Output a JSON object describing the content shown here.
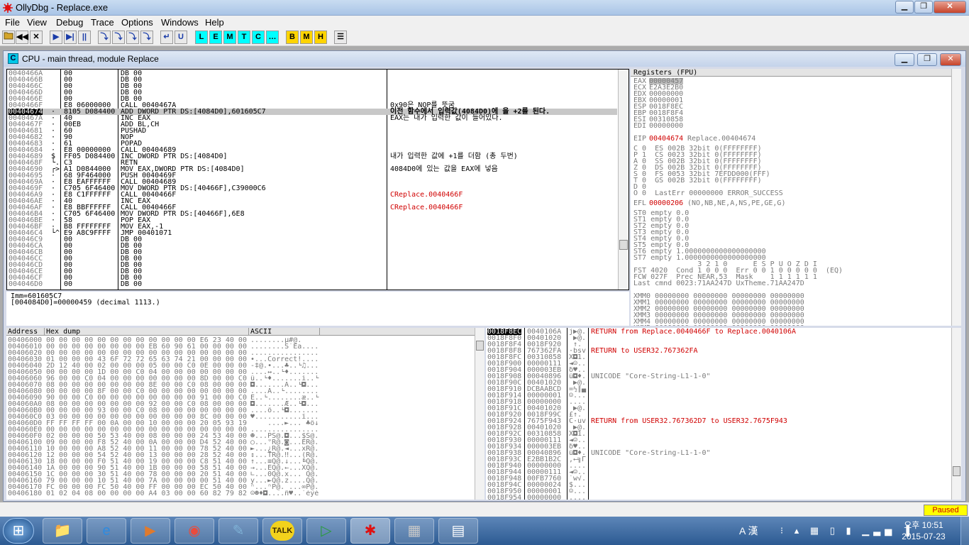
{
  "window": {
    "title": "OllyDbg - Replace.exe"
  },
  "menu": [
    "File",
    "View",
    "Debug",
    "Trace",
    "Options",
    "Windows",
    "Help"
  ],
  "toolbar": {
    "blue": [
      "◀◀",
      "✕",
      "▶",
      "▶|",
      "||",
      "⤵",
      "⤵",
      "⤵",
      "⤵",
      "↵",
      "U"
    ],
    "cyan": [
      "L",
      "E",
      "M",
      "T",
      "C",
      "…"
    ],
    "yellow": [
      "B",
      "M",
      "H"
    ],
    "list": "☰"
  },
  "cpu": {
    "title": "CPU - main thread, module Replace",
    "disasm": [
      {
        "addr": "0040466A",
        "mark": "",
        "hex": "00",
        "asm": "DB 00",
        "cmt": ""
      },
      {
        "addr": "0040466B",
        "mark": "",
        "hex": "00",
        "asm": "DB 00",
        "cmt": ""
      },
      {
        "addr": "0040466C",
        "mark": "",
        "hex": "00",
        "asm": "DB 00",
        "cmt": ""
      },
      {
        "addr": "0040466D",
        "mark": "",
        "hex": "00",
        "asm": "DB 00",
        "cmt": ""
      },
      {
        "addr": "0040466E",
        "mark": "",
        "hex": "00",
        "asm": "DB 00",
        "cmt": ""
      },
      {
        "addr": "0040466F",
        "mark": "",
        "hex": "E8 06000000",
        "asm": "CALL 0040467A",
        "cmt": "0x90은 NOP를 뜻굼"
      },
      {
        "addr": "00404674",
        "mark": "·",
        "hex": "8105 D084400",
        "asm": "ADD DWORD PTR DS:[4084D0],601605C7",
        "cmt": "이전 함수에서 입력값(4084D0)에 을 +2를 된다.",
        "sel": true
      },
      {
        "addr": "0040467A",
        "mark": "·",
        "hex": "40",
        "asm": "INC EAX",
        "cmt": "EAX는 내가 입력한 값이 들어있다."
      },
      {
        "addr": "0040467F",
        "mark": "·",
        "hex": "00EB",
        "asm": "ADD BL,CH",
        "cmt": ""
      },
      {
        "addr": "00404681",
        "mark": "·",
        "hex": "60",
        "asm": "PUSHAD",
        "cmt": ""
      },
      {
        "addr": "00404682",
        "mark": "·",
        "hex": "90",
        "asm": "NOP",
        "cmt": ""
      },
      {
        "addr": "00404683",
        "mark": "·",
        "hex": "61",
        "asm": "POPAD",
        "cmt": ""
      },
      {
        "addr": "00404684",
        "mark": "·",
        "hex": "E8 00000000",
        "asm": "CALL 00404689",
        "cmt": ""
      },
      {
        "addr": "00404689",
        "mark": "$",
        "hex": "FF05 D084400",
        "asm": "INC DWORD PTR DS:[4084D0]",
        "cmt": "내가 입력한 값에 +1를 더함 (총 두번)"
      },
      {
        "addr": "0040468F",
        "mark": "└.",
        "hex": "C3",
        "asm": "RETN",
        "cmt": ""
      },
      {
        "addr": "00404690",
        "mark": "┌>",
        "hex": "A1 D0844000",
        "asm": "MOV EAX,DWORD PTR DS:[4084D0]",
        "cmt": "4084D0에 있는 값을 EAX에 넣음"
      },
      {
        "addr": "00404695",
        "mark": "·",
        "hex": "68 9F464000",
        "asm": "PUSH 0040469F",
        "cmt": ""
      },
      {
        "addr": "0040469A",
        "mark": "·",
        "hex": "E8 EAFFFFFF",
        "asm": "CALL 00404689",
        "cmt": ""
      },
      {
        "addr": "0040469F",
        "mark": "·",
        "hex": "C705 6F46400",
        "asm": "MOV DWORD PTR DS:[40466F],C39000C6",
        "cmt": ""
      },
      {
        "addr": "004046A9",
        "mark": "·",
        "hex": "E8 C1FFFFFF",
        "asm": "CALL 0040466F",
        "cmt": "CReplace.0040466F",
        "cmtred": true
      },
      {
        "addr": "004046AE",
        "mark": "·",
        "hex": "40",
        "asm": "INC EAX",
        "cmt": ""
      },
      {
        "addr": "004046AF",
        "mark": "·",
        "hex": "E8 BBFFFFFF",
        "asm": "CALL 0040466F",
        "cmt": "CReplace.0040466F",
        "cmtred": true
      },
      {
        "addr": "004046B4",
        "mark": "·",
        "hex": "C705 6F46400",
        "asm": "MOV DWORD PTR DS:[40466F],6E8",
        "cmt": ""
      },
      {
        "addr": "004046BE",
        "mark": "·",
        "hex": "58",
        "asm": "POP EAX",
        "cmt": ""
      },
      {
        "addr": "004046BF",
        "mark": "·",
        "hex": "B8 FFFFFFFF",
        "asm": "MOV EAX,-1",
        "cmt": ""
      },
      {
        "addr": "004046C4",
        "mark": "└^",
        "hex": "E9 A8C9FFFF",
        "asm": "JMP 00401071",
        "cmt": ""
      },
      {
        "addr": "004046C9",
        "mark": "",
        "hex": "00",
        "asm": "DB 00",
        "cmt": ""
      },
      {
        "addr": "004046CA",
        "mark": "",
        "hex": "00",
        "asm": "DB 00",
        "cmt": ""
      },
      {
        "addr": "004046CB",
        "mark": "",
        "hex": "00",
        "asm": "DB 00",
        "cmt": ""
      },
      {
        "addr": "004046CC",
        "mark": "",
        "hex": "00",
        "asm": "DB 00",
        "cmt": ""
      },
      {
        "addr": "004046CD",
        "mark": "",
        "hex": "00",
        "asm": "DB 00",
        "cmt": ""
      },
      {
        "addr": "004046CE",
        "mark": "",
        "hex": "00",
        "asm": "DB 00",
        "cmt": ""
      },
      {
        "addr": "004046CF",
        "mark": "",
        "hex": "00",
        "asm": "DB 00",
        "cmt": ""
      },
      {
        "addr": "004046D0",
        "mark": "",
        "hex": "00",
        "asm": "DB 00",
        "cmt": ""
      }
    ],
    "info": [
      "Imm=601605C7",
      "[004084D0]=00000459 (decimal 1113.)"
    ],
    "registers": {
      "header": "Registers (FPU)",
      "gpr": [
        {
          "n": "EAX",
          "v": "00000457",
          "hl": true,
          "extra": ""
        },
        {
          "n": "ECX",
          "v": "E2A3E2B0",
          "extra": ""
        },
        {
          "n": "EDX",
          "v": "00000000",
          "extra": ""
        },
        {
          "n": "EBX",
          "v": "00000001",
          "extra": ""
        },
        {
          "n": "ESP",
          "v": "0018F8EC",
          "extra": ""
        },
        {
          "n": "EBP",
          "v": "0018F8F4",
          "extra": ""
        },
        {
          "n": "ESI",
          "v": "00310858",
          "extra": ""
        },
        {
          "n": "EDI",
          "v": "00000000",
          "extra": ""
        }
      ],
      "eip": {
        "n": "EIP",
        "v": "00404674",
        "extra": "Replace.00404674"
      },
      "flags": [
        "C 0  ES 002B 32bit 0(FFFFFFFF)",
        "P 1  CS 0023 32bit 0(FFFFFFFF)",
        "A 0  SS 002B 32bit 0(FFFFFFFF)",
        "Z 0  DS 002B 32bit 0(FFFFFFFF)",
        "S 0  FS 0053 32bit 7EFDD000(FFF)",
        "T 0  GS 002B 32bit 0(FFFFFFFF)",
        "D 0",
        "O 0  LastErr 00000000 ERROR_SUCCESS"
      ],
      "efl": {
        "n": "EFL",
        "v": "00000206",
        "extra": "(NO,NB,NE,A,NS,PE,GE,G)"
      },
      "fpu": [
        "ST0 empty 0.0",
        "ST1 empty 0.0",
        "ST2 empty 0.0",
        "ST3 empty 0.0",
        "ST4 empty 0.0",
        "ST5 empty 0.0",
        "ST6 empty 1.0000000000000000000",
        "ST7 empty 1.0000000000000000000",
        "               3 2 1 0      E S P U O Z D I",
        "FST 4020  Cond 1 0 0 0  Err 0 0 1 0 0 0 0 0  (EQ)",
        "FCW 027F  Prec NEAR,53  Mask    1 1 1 1 1 1",
        "Last cmnd 0023:71AA247D UxTheme.71AA247D"
      ],
      "xmm": [
        "XMM0 00000000 00000000 00000000 00000000",
        "XMM1 00000000 00000000 00000000 00000000",
        "XMM2 00000000 00000000 00000000 00000000",
        "XMM3 00000000 00000000 00000000 00000000",
        "XMM4 00000000 00000000 00000000 00000000",
        "XMM5 00000000 00000000 00000000 00000000"
      ]
    },
    "dump": {
      "headers": [
        "Address",
        "Hex dump",
        "ASCII"
      ],
      "rows": [
        [
          "00406000",
          "00 00 00 00 00 00 00 00 00 00 00 00 E6 23 40 00",
          "........µ#@."
        ],
        [
          "00406010",
          "00 00 00 00 00 00 00 00 EB 60 90 61 00 00 00 00",
          "........Š`Ea...."
        ],
        [
          "00406020",
          "00 00 00 00 00 00 00 00 00 00 00 00 00 00 00 00",
          "................"
        ],
        [
          "00406030",
          "01 00 00 00 43 6F 72 72 65 63 74 21 00 00 00 00",
          "•...Correct!...."
        ],
        [
          "00406040",
          "2D 12 40 00 02 00 00 00 05 00 00 C0 0E 00 00 00",
          "-‡@.•...♣..└♫..."
        ],
        [
          "00406050",
          "00 00 00 00 1D 00 00 C0 04 00 00 00 00 00 00 00",
          "....↔..└♦......."
        ],
        [
          "00406060",
          "96 00 00 C0 04 00 00 00 00 00 00 00 8D 00 00 C0",
          "û..└♦.......ì..└"
        ],
        [
          "00406070",
          "08 00 00 00 00 00 00 00 8E 00 00 C0 08 00 00 00",
          "◘.......Ä..└◘..."
        ],
        [
          "00406080",
          "00 00 00 00 8F 00 00 C0 00 00 00 00 00 00 00 00",
          "....Å..└........"
        ],
        [
          "00406090",
          "90 00 00 C0 00 00 00 00 00 00 00 00 91 00 00 C0",
          "É..└........æ..└"
        ],
        [
          "004060A0",
          "08 00 00 00 00 00 00 00 92 00 00 C0 08 00 00 00",
          "◘.......Æ..└◘..."
        ],
        [
          "004060B0",
          "00 00 00 00 93 00 00 C0 08 00 00 00 00 00 00 00",
          "....ô..└◘......."
        ],
        [
          "004060C0",
          "03 00 00 00 00 00 00 00 00 00 00 00 8C 00 00 00",
          "♥...........î..."
        ],
        [
          "004060D0",
          "FF FF FF FF 00 0A 00 00 10 00 00 00 20 05 93 19",
          "    ....►... ♣ô↓"
        ],
        [
          "004060E0",
          "00 00 00 00 00 00 00 00 00 00 00 00 00 00 00 00",
          "................"
        ],
        [
          "004060F0",
          "02 00 00 00 50 53 40 00 08 00 00 00 24 53 40 00",
          "☻...PS@.◘...$S@."
        ],
        [
          "00406100",
          "09 00 00 00 F8 52 40 00 0A 00 00 00 D4 52 40 00",
          "○...°R@.◙...ÈR@."
        ],
        [
          "00406110",
          "10 00 00 00 A8 52 40 00 11 00 00 00 78 52 40 00",
          "►...¿R@.◄...xR@."
        ],
        [
          "00406120",
          "12 00 00 00 54 52 40 00 13 00 00 00 28 52 40 00",
          "↕...TR@.‼...(R@."
        ],
        [
          "00406130",
          "18 00 00 00 F0 51 40 00 19 00 00 00 C8 51 40 00",
          "↑...≡Q@.↓...╚Q@."
        ],
        [
          "00406140",
          "1A 00 00 00 90 51 40 00 1B 00 00 00 58 51 40 00",
          "→...ÉQ@.←...XQ@."
        ],
        [
          "00406150",
          "1C 00 00 00 30 51 40 00 78 00 00 00 20 51 40 00",
          "∟...0Q@.x... Q@."
        ],
        [
          "00406160",
          "79 00 00 00 10 51 40 00 7A 00 00 00 00 51 40 00",
          "y...►Q@.z....Q@."
        ],
        [
          "00406170",
          "FC 00 00 00 FC 50 40 00 FF 00 00 00 EC 50 40 00",
          "ⁿ...ⁿP@. ...∞P@."
        ],
        [
          "00406180",
          "01 02 04 08 00 00 00 00 A4 03 00 00 60 82 79 82",
          "☺☻♦◘....ñ♥..`éyé"
        ]
      ]
    },
    "stack": {
      "rows": [
        {
          "a": "0018F8EC",
          "v": "0040106A",
          "g": "j▶@.",
          "c": "RETURN from Replace.0040466F to Replace.0040106A",
          "red": true,
          "sel": true
        },
        {
          "a": "0018F8F0",
          "v": "00401020",
          "g": " ▶@.",
          "c": ""
        },
        {
          "a": "0018F8F4",
          "v": "0018F920",
          "g": " ↑.",
          "c": ""
        },
        {
          "a": "0018F8F8",
          "v": "767362FA",
          "g": "·bsv",
          "c": "RETURN to USER32.767362FA",
          "red": true
        },
        {
          "a": "0018F8FC",
          "v": "00310858",
          "g": "X◘1.",
          "c": ""
        },
        {
          "a": "0018F900",
          "v": "00000111",
          "g": "◄☺..",
          "c": ""
        },
        {
          "a": "0018F904",
          "v": "000003EB",
          "g": "δ♥..",
          "c": ""
        },
        {
          "a": "0018F908",
          "v": "00040896",
          "g": "û◘♦.",
          "c": "UNICODE \"Core-String-L1-1-0\""
        },
        {
          "a": "0018F90C",
          "v": "00401020",
          "g": " ▶@.",
          "c": ""
        },
        {
          "a": "0018F910",
          "v": "DCBAABCD",
          "g": "=½║▄",
          "c": ""
        },
        {
          "a": "0018F914",
          "v": "00000001",
          "g": "☺...",
          "c": ""
        },
        {
          "a": "0018F918",
          "v": "00000000",
          "g": "....",
          "c": ""
        },
        {
          "a": "0018F91C",
          "v": "00401020",
          "g": " ▶@.",
          "c": ""
        },
        {
          "a": "0018F920",
          "v": "0018F99C",
          "g": "£↑.",
          "c": ""
        },
        {
          "a": "0018F924",
          "v": "7675F943",
          "g": "C·uv",
          "c": "RETURN from USER32.767362D7 to USER32.7675F943",
          "red": true
        },
        {
          "a": "0018F928",
          "v": "00401020",
          "g": " ▶@.",
          "c": ""
        },
        {
          "a": "0018F92C",
          "v": "00310858",
          "g": "X◘1.",
          "c": ""
        },
        {
          "a": "0018F930",
          "v": "00000111",
          "g": "◄☺..",
          "c": ""
        },
        {
          "a": "0018F934",
          "v": "000003EB",
          "g": "δ♥..",
          "c": ""
        },
        {
          "a": "0018F938",
          "v": "00040896",
          "g": "û◘♦.",
          "c": "UNICODE \"Core-String-L1-1-0\""
        },
        {
          "a": "0018F93C",
          "v": "E2BB1B2C",
          "g": ",←╗Γ",
          "c": ""
        },
        {
          "a": "0018F940",
          "v": "00000000",
          "g": "....",
          "c": ""
        },
        {
          "a": "0018F944",
          "v": "00000111",
          "g": "◄☺..",
          "c": ""
        },
        {
          "a": "0018F948",
          "v": "00FB7760",
          "g": "`w√.",
          "c": ""
        },
        {
          "a": "0018F94C",
          "v": "00000024",
          "g": "$...",
          "c": ""
        },
        {
          "a": "0018F950",
          "v": "00000001",
          "g": "☺...",
          "c": ""
        },
        {
          "a": "0018F954",
          "v": "00000000",
          "g": "....",
          "c": ""
        }
      ]
    }
  },
  "status": {
    "paused": "Paused"
  },
  "taskbar": {
    "start": "⊞",
    "apps": [
      {
        "name": "explorer",
        "glyph": "📁"
      },
      {
        "name": "ie",
        "glyph": "e"
      },
      {
        "name": "media",
        "glyph": "▶"
      },
      {
        "name": "chrome",
        "glyph": "◉"
      },
      {
        "name": "notes",
        "glyph": "✎"
      },
      {
        "name": "talk",
        "glyph": "TALK"
      },
      {
        "name": "gom",
        "glyph": "▷"
      },
      {
        "name": "ollydbg",
        "glyph": "✱"
      },
      {
        "name": "calc",
        "glyph": "▦"
      },
      {
        "name": "file",
        "glyph": "▤"
      }
    ],
    "ime": "A 漢",
    "time": "오후 10:51",
    "date": "2015-07-23"
  }
}
